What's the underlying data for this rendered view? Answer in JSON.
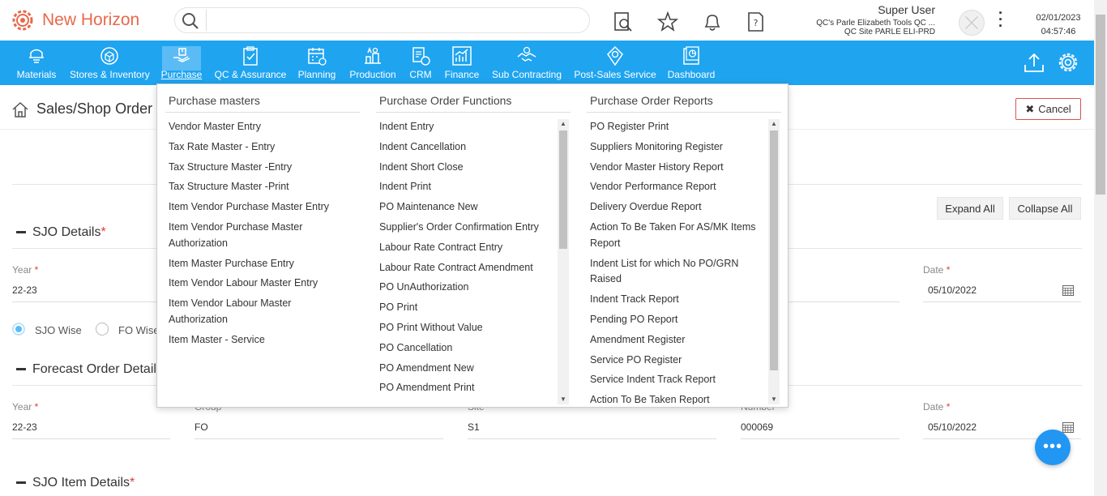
{
  "header": {
    "brand": "New Horizon",
    "user_name": "Super User",
    "user_org": "QC's Parle Elizabeth Tools QC ...",
    "user_site": "QC Site PARLE ELI-PRD",
    "date": "02/01/2023",
    "time": "04:57:46",
    "icons": [
      "search-icon",
      "document-search-icon",
      "star-icon",
      "bell-icon",
      "help-document-icon",
      "avatar",
      "kebab-menu-icon"
    ]
  },
  "nav": {
    "items": [
      {
        "label": "Materials",
        "icon": "materials-icon"
      },
      {
        "label": "Stores & Inventory",
        "icon": "stores-icon"
      },
      {
        "label": "Purchase",
        "icon": "purchase-icon",
        "active": true
      },
      {
        "label": "QC & Assurance",
        "icon": "qc-icon"
      },
      {
        "label": "Planning",
        "icon": "planning-icon"
      },
      {
        "label": "Production",
        "icon": "production-icon"
      },
      {
        "label": "CRM",
        "icon": "crm-icon"
      },
      {
        "label": "Finance",
        "icon": "finance-icon"
      },
      {
        "label": "Sub Contracting",
        "icon": "subcontracting-icon"
      },
      {
        "label": "Post-Sales Service",
        "icon": "postsales-icon"
      },
      {
        "label": "Dashboard",
        "icon": "dashboard-icon"
      }
    ],
    "right_icons": [
      "upload-icon",
      "settings-icon"
    ]
  },
  "page": {
    "title": "Sales/Shop Order I",
    "cancel_label": "Cancel",
    "expand_all": "Expand All",
    "collapse_all": "Collapse All"
  },
  "sjo_details": {
    "title": "SJO Details",
    "req": "*",
    "year_label": "Year",
    "year_value": "22-23",
    "date_label": "Date",
    "date_value": "05/10/2022",
    "radio_sjo": "SJO Wise",
    "radio_fo": "FO Wise"
  },
  "forecast": {
    "title": "Forecast Order Details",
    "year_label": "Year",
    "year_value": "22-23",
    "group_label": "Group",
    "group_value": "FO",
    "site_label": "Site",
    "site_value": "S1",
    "number_label": "Number",
    "number_value": "000069",
    "date_label": "Date",
    "date_value": "05/10/2022"
  },
  "sjo_item": {
    "title": "SJO Item Details",
    "req": "*"
  },
  "menu": {
    "col1": {
      "title": "Purchase masters",
      "items": [
        "Vendor Master Entry",
        "Tax Rate Master - Entry",
        "Tax Structure Master -Entry",
        "Tax Structure Master -Print",
        "Item Vendor Purchase Master Entry",
        "Item Vendor Purchase Master Authorization",
        "Item Master Purchase Entry",
        "Item Vendor Labour Master Entry",
        "Item Vendor Labour Master Authorization",
        "Item Master - Service"
      ]
    },
    "col2": {
      "title": "Purchase Order Functions",
      "items": [
        "Indent Entry",
        "Indent Cancellation",
        "Indent Short Close",
        "Indent Print",
        "PO Maintenance New",
        "Supplier's Order Confirmation Entry",
        "Labour Rate Contract Entry",
        "Labour Rate Contract Amendment",
        "PO UnAuthorization",
        "PO Print",
        "PO Print Without Value",
        "PO Cancellation",
        "PO Amendment New",
        "PO Amendment Print"
      ]
    },
    "col3": {
      "title": "Purchase Order Reports",
      "items": [
        "PO Register Print",
        "Suppliers Monitoring Register",
        "Vendor Master History Report",
        "Vendor Performance Report",
        "Delivery Overdue Report",
        "Action To Be Taken For AS/MK Items Report",
        "Indent List for which No PO/GRN Raised",
        "Indent Track Report",
        "Pending PO Report",
        "Amendment Register",
        "Service PO Register",
        "Service Indent Track Report",
        "Action To Be Taken Report"
      ]
    }
  },
  "colors": {
    "brand": "#e8694a",
    "nav_bg": "#1fa4f0",
    "nav_active": "#5bbcf5",
    "cancel_border": "#d9534f",
    "chat": "#2196f3"
  }
}
